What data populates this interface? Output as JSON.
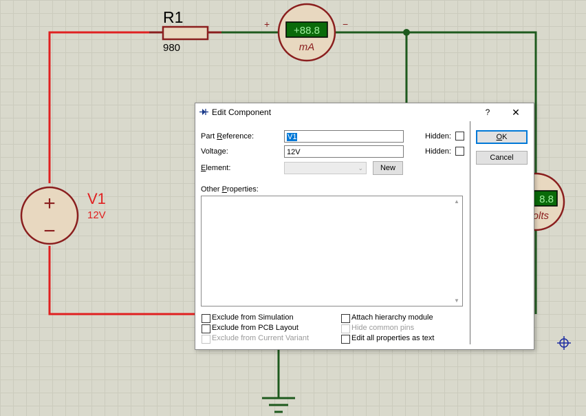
{
  "schematic": {
    "resistor": {
      "name": "R1",
      "value": "980"
    },
    "source": {
      "name": "V1",
      "value": "12V",
      "plus": "+",
      "minus": "−"
    },
    "ammeter": {
      "display": "+88.8",
      "unit": "mA",
      "plus": "+",
      "minus": "−"
    },
    "voltmeter": {
      "display": "8.8",
      "unit_partial": "olts"
    },
    "wire_red": "#e02020",
    "wire_green": "#1e5a1e"
  },
  "dialog": {
    "title": "Edit Component",
    "help": "?",
    "close": "✕",
    "part_reference": {
      "label_pre": "Part ",
      "label_ul": "R",
      "label_post": "eference:",
      "value": "V1",
      "hidden_label": "Hidden:"
    },
    "voltage": {
      "label": "Voltage:",
      "value": "12V",
      "hidden_label": "Hidden:"
    },
    "element": {
      "label_ul": "E",
      "label_post": "lement:",
      "value": "",
      "new_button": "New"
    },
    "other_properties": {
      "label_pre": "Other ",
      "label_ul": "P",
      "label_post": "roperties:",
      "value": ""
    },
    "checkboxes": {
      "exclude_simulation": "Exclude from Simulation",
      "exclude_pcb": "Exclude from PCB Layout",
      "exclude_variant": "Exclude from Current Variant",
      "attach_hierarchy": "Attach hierarchy module",
      "hide_pins": "Hide common pins",
      "edit_all": "Edit all properties as text"
    },
    "ok_button": {
      "label_ul": "O",
      "label_post": "K"
    },
    "cancel_button": "Cancel"
  },
  "colors": {
    "accent": "#0078d7"
  }
}
